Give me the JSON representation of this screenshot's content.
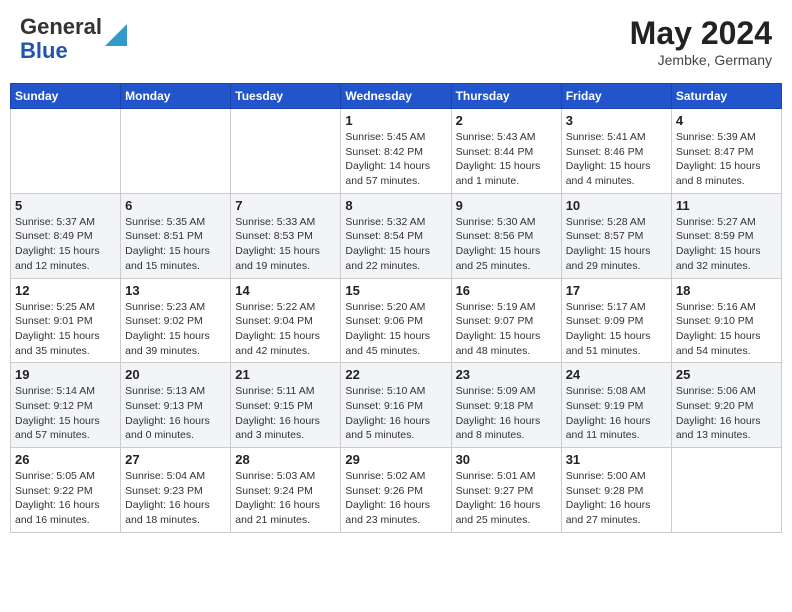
{
  "header": {
    "logo_line1": "General",
    "logo_line2": "Blue",
    "month_year": "May 2024",
    "location": "Jembke, Germany"
  },
  "days_of_week": [
    "Sunday",
    "Monday",
    "Tuesday",
    "Wednesday",
    "Thursday",
    "Friday",
    "Saturday"
  ],
  "weeks": [
    [
      {
        "day": "",
        "info": ""
      },
      {
        "day": "",
        "info": ""
      },
      {
        "day": "",
        "info": ""
      },
      {
        "day": "1",
        "info": "Sunrise: 5:45 AM\nSunset: 8:42 PM\nDaylight: 14 hours\nand 57 minutes."
      },
      {
        "day": "2",
        "info": "Sunrise: 5:43 AM\nSunset: 8:44 PM\nDaylight: 15 hours\nand 1 minute."
      },
      {
        "day": "3",
        "info": "Sunrise: 5:41 AM\nSunset: 8:46 PM\nDaylight: 15 hours\nand 4 minutes."
      },
      {
        "day": "4",
        "info": "Sunrise: 5:39 AM\nSunset: 8:47 PM\nDaylight: 15 hours\nand 8 minutes."
      }
    ],
    [
      {
        "day": "5",
        "info": "Sunrise: 5:37 AM\nSunset: 8:49 PM\nDaylight: 15 hours\nand 12 minutes."
      },
      {
        "day": "6",
        "info": "Sunrise: 5:35 AM\nSunset: 8:51 PM\nDaylight: 15 hours\nand 15 minutes."
      },
      {
        "day": "7",
        "info": "Sunrise: 5:33 AM\nSunset: 8:53 PM\nDaylight: 15 hours\nand 19 minutes."
      },
      {
        "day": "8",
        "info": "Sunrise: 5:32 AM\nSunset: 8:54 PM\nDaylight: 15 hours\nand 22 minutes."
      },
      {
        "day": "9",
        "info": "Sunrise: 5:30 AM\nSunset: 8:56 PM\nDaylight: 15 hours\nand 25 minutes."
      },
      {
        "day": "10",
        "info": "Sunrise: 5:28 AM\nSunset: 8:57 PM\nDaylight: 15 hours\nand 29 minutes."
      },
      {
        "day": "11",
        "info": "Sunrise: 5:27 AM\nSunset: 8:59 PM\nDaylight: 15 hours\nand 32 minutes."
      }
    ],
    [
      {
        "day": "12",
        "info": "Sunrise: 5:25 AM\nSunset: 9:01 PM\nDaylight: 15 hours\nand 35 minutes."
      },
      {
        "day": "13",
        "info": "Sunrise: 5:23 AM\nSunset: 9:02 PM\nDaylight: 15 hours\nand 39 minutes."
      },
      {
        "day": "14",
        "info": "Sunrise: 5:22 AM\nSunset: 9:04 PM\nDaylight: 15 hours\nand 42 minutes."
      },
      {
        "day": "15",
        "info": "Sunrise: 5:20 AM\nSunset: 9:06 PM\nDaylight: 15 hours\nand 45 minutes."
      },
      {
        "day": "16",
        "info": "Sunrise: 5:19 AM\nSunset: 9:07 PM\nDaylight: 15 hours\nand 48 minutes."
      },
      {
        "day": "17",
        "info": "Sunrise: 5:17 AM\nSunset: 9:09 PM\nDaylight: 15 hours\nand 51 minutes."
      },
      {
        "day": "18",
        "info": "Sunrise: 5:16 AM\nSunset: 9:10 PM\nDaylight: 15 hours\nand 54 minutes."
      }
    ],
    [
      {
        "day": "19",
        "info": "Sunrise: 5:14 AM\nSunset: 9:12 PM\nDaylight: 15 hours\nand 57 minutes."
      },
      {
        "day": "20",
        "info": "Sunrise: 5:13 AM\nSunset: 9:13 PM\nDaylight: 16 hours\nand 0 minutes."
      },
      {
        "day": "21",
        "info": "Sunrise: 5:11 AM\nSunset: 9:15 PM\nDaylight: 16 hours\nand 3 minutes."
      },
      {
        "day": "22",
        "info": "Sunrise: 5:10 AM\nSunset: 9:16 PM\nDaylight: 16 hours\nand 5 minutes."
      },
      {
        "day": "23",
        "info": "Sunrise: 5:09 AM\nSunset: 9:18 PM\nDaylight: 16 hours\nand 8 minutes."
      },
      {
        "day": "24",
        "info": "Sunrise: 5:08 AM\nSunset: 9:19 PM\nDaylight: 16 hours\nand 11 minutes."
      },
      {
        "day": "25",
        "info": "Sunrise: 5:06 AM\nSunset: 9:20 PM\nDaylight: 16 hours\nand 13 minutes."
      }
    ],
    [
      {
        "day": "26",
        "info": "Sunrise: 5:05 AM\nSunset: 9:22 PM\nDaylight: 16 hours\nand 16 minutes."
      },
      {
        "day": "27",
        "info": "Sunrise: 5:04 AM\nSunset: 9:23 PM\nDaylight: 16 hours\nand 18 minutes."
      },
      {
        "day": "28",
        "info": "Sunrise: 5:03 AM\nSunset: 9:24 PM\nDaylight: 16 hours\nand 21 minutes."
      },
      {
        "day": "29",
        "info": "Sunrise: 5:02 AM\nSunset: 9:26 PM\nDaylight: 16 hours\nand 23 minutes."
      },
      {
        "day": "30",
        "info": "Sunrise: 5:01 AM\nSunset: 9:27 PM\nDaylight: 16 hours\nand 25 minutes."
      },
      {
        "day": "31",
        "info": "Sunrise: 5:00 AM\nSunset: 9:28 PM\nDaylight: 16 hours\nand 27 minutes."
      },
      {
        "day": "",
        "info": ""
      }
    ]
  ]
}
